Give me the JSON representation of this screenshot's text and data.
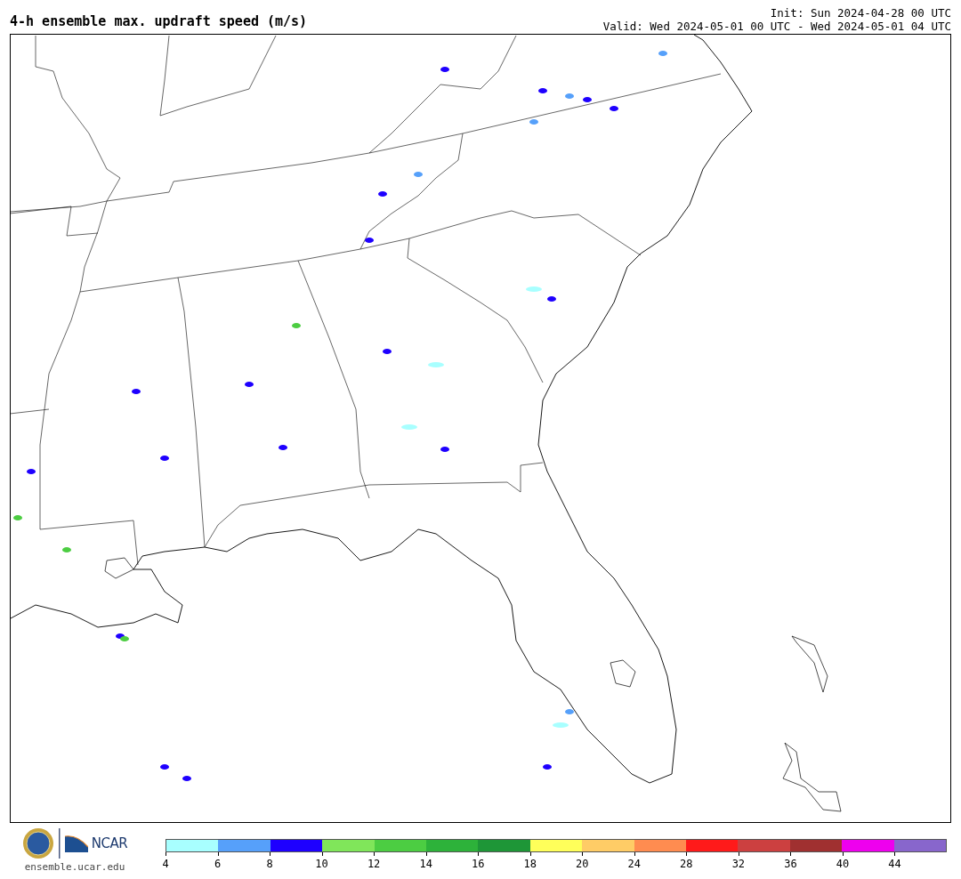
{
  "title": "4-h ensemble max. updraft speed (m/s)",
  "init": "Init: Sun 2024-04-28 00 UTC",
  "valid": "Valid: Wed 2024-05-01 00 UTC - Wed 2024-05-01 04 UTC",
  "footer": {
    "logo_text": "NCAR",
    "site": "ensemble.ucar.edu"
  },
  "colorbar": {
    "segments": [
      {
        "color": "#a8ffff"
      },
      {
        "color": "#56a0fa"
      },
      {
        "color": "#1e00ff"
      },
      {
        "color": "#80e65a"
      },
      {
        "color": "#4ccd42"
      },
      {
        "color": "#2db23a"
      },
      {
        "color": "#1e9637"
      },
      {
        "color": "#ffff5a"
      },
      {
        "color": "#ffcc66"
      },
      {
        "color": "#ff8c50"
      },
      {
        "color": "#ff1a1a"
      },
      {
        "color": "#cc4040"
      },
      {
        "color": "#a03030"
      },
      {
        "color": "#ee00ee"
      },
      {
        "color": "#8866cc"
      }
    ],
    "ticks": [
      "4",
      "6",
      "8",
      "10",
      "12",
      "14",
      "16",
      "18",
      "20",
      "24",
      "28",
      "32",
      "36",
      "40",
      "44"
    ]
  }
}
